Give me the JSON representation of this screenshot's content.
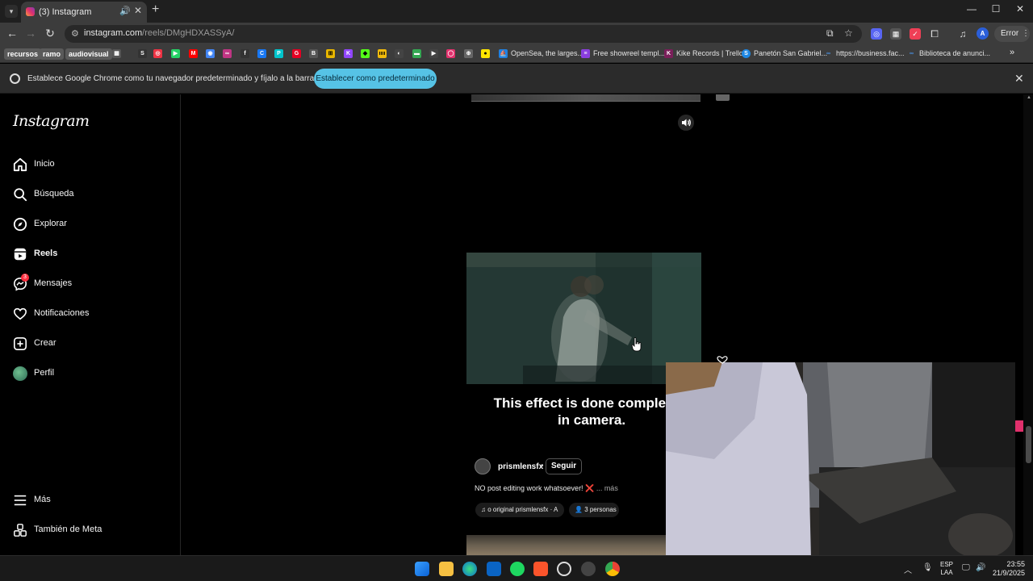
{
  "browser": {
    "tab_title": "(3) Instagram",
    "url_host": "instagram.com",
    "url_path": "/reels/DMgHDXASSyA/",
    "error_label": "Error",
    "profile_initial": "A",
    "window_controls": [
      "—",
      "☐",
      "✕"
    ]
  },
  "bookmarks": {
    "folders": [
      {
        "label": "recursos",
        "color": "#5f6368"
      },
      {
        "label": "ramo",
        "color": "#5f6368"
      },
      {
        "label": "audiovisual",
        "color": "#5f6368"
      }
    ],
    "icon_letters": [
      "S",
      "◎",
      "▶",
      "M",
      "◉",
      "∞",
      "f",
      "C",
      "P",
      "G",
      "B",
      "⊞",
      "K",
      "◆",
      "ıııı",
      "◐",
      "▬",
      "▶",
      "◯",
      "⊕"
    ],
    "named": [
      {
        "label": "OpenSea, the larges..."
      },
      {
        "label": "Free showreel templ..."
      },
      {
        "label": "Kike Records | Trello"
      },
      {
        "label": "Panetón San Gabriel..."
      },
      {
        "label": "https://business.fac..."
      },
      {
        "label": "Biblioteca de anunci..."
      }
    ]
  },
  "infobar": {
    "message": "Establece Google Chrome como tu navegador predeterminado y fíjalo a la barra de tareas",
    "button": "Establecer como predeterminado"
  },
  "instagram": {
    "logo": "Instagram",
    "nav": [
      {
        "label": "Inicio",
        "icon": "home-icon"
      },
      {
        "label": "Búsqueda",
        "icon": "search-icon"
      },
      {
        "label": "Explorar",
        "icon": "compass-icon"
      },
      {
        "label": "Reels",
        "icon": "reels-icon"
      },
      {
        "label": "Mensajes",
        "icon": "messenger-icon"
      },
      {
        "label": "Notificaciones",
        "icon": "heart-icon"
      },
      {
        "label": "Crear",
        "icon": "plus-square-icon"
      },
      {
        "label": "Perfil",
        "icon": "avatar"
      }
    ],
    "messages_badge": "3",
    "more": "Más",
    "meta": "También de Meta"
  },
  "reel": {
    "caption": "This effect is done completely in camera.",
    "author": "prismlensfx",
    "dot": "•",
    "follow": "Seguir",
    "description": "NO post editing work whatsoever!",
    "description_mark": "❌",
    "more": "... más",
    "audio": "o original  prismlensfx · A",
    "people": "3 personas"
  },
  "taskbar": {
    "lang_top": "ESP",
    "lang_bottom": "LAA",
    "time": "23:55",
    "date": "21/9/2025"
  }
}
